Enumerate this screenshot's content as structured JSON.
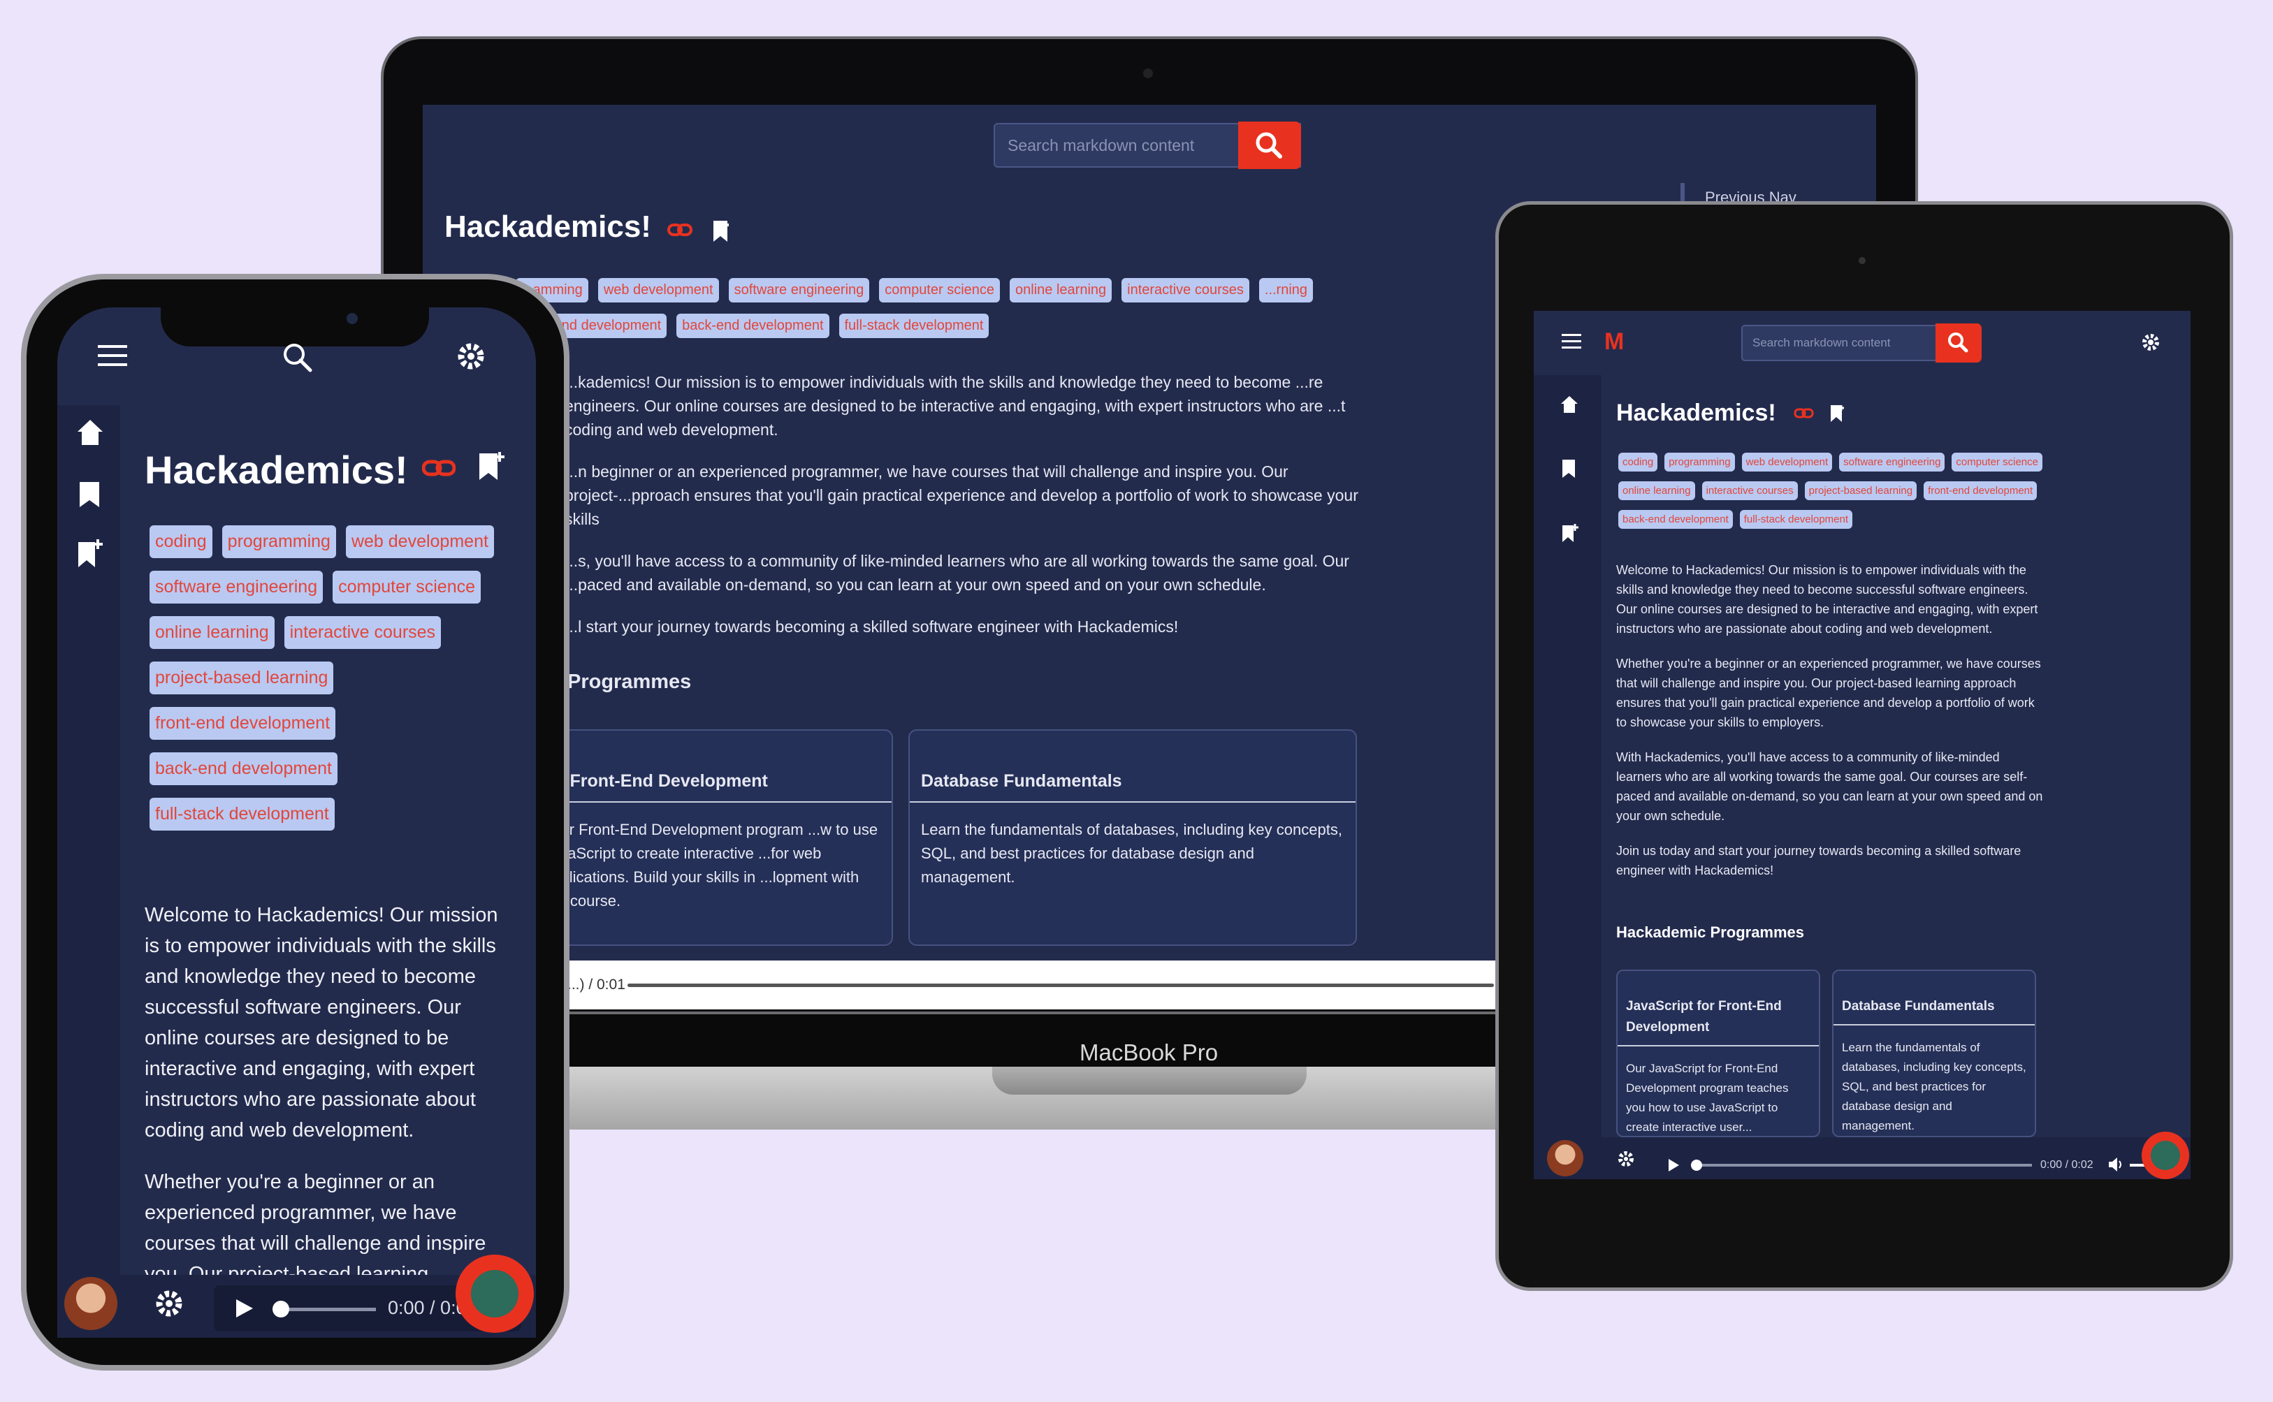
{
  "colors": {
    "background": "#ebe4fb",
    "screen": "#232b4d",
    "sidebar": "#1d2443",
    "accent": "#e8321f",
    "tag_bg": "#b9c9f2",
    "tag_text": "#e2463b"
  },
  "laptop": {
    "search_placeholder": "Search markdown content",
    "title": "Hackademics!",
    "prev_nav": "Previous Nav",
    "tags": [
      "...amming",
      "web development",
      "software engineering",
      "computer science",
      "online learning",
      "interactive courses",
      "...rning",
      "front-end development",
      "back-end development",
      "full-stack development"
    ],
    "paragraphs": [
      "...kademics! Our mission is to empower individuals with the skills and knowledge they need to become ...re engineers. Our online courses are designed to be interactive and engaging, with expert instructors who are ...t coding and web development.",
      "...n beginner or an experienced programmer, we have courses that will challenge and inspire you. Our project-...pproach ensures that you'll gain practical experience and develop a portfolio of work to showcase your skills",
      "...s, you'll have access to a community of like-minded learners who are all working towards the same goal. Our ...paced and available on-demand, so you can learn at your own speed and on your own schedule.",
      "...l start your journey towards becoming a skilled software engineer with Hackademics!"
    ],
    "programmes_heading": "Programmes",
    "cards": [
      {
        "title": "...r Front-End Development",
        "text": "...for Front-End Development program ...w to use JavaScript to create interactive ...for web applications. Build your skills in ...lopment with our course."
      },
      {
        "title": "Database Fundamentals",
        "text": "Learn the fundamentals of databases, including key concepts, SQL, and best practices for database design and management."
      }
    ],
    "audio_time": "...) / 0:01",
    "model": "MacBook Pro"
  },
  "tablet": {
    "logo": "M",
    "search_placeholder": "Search markdown content",
    "title": "Hackademics!",
    "tags": [
      "coding",
      "programming",
      "web development",
      "software engineering",
      "computer science",
      "online learning",
      "interactive courses",
      "project-based learning",
      "front-end development",
      "back-end development",
      "full-stack development"
    ],
    "paragraphs": [
      "Welcome to Hackademics! Our mission is to empower individuals with the skills and knowledge they need to become successful software engineers. Our online courses are designed to be interactive and engaging, with expert instructors who are passionate about coding and web development.",
      "Whether you're a beginner or an experienced programmer, we have courses that will challenge and inspire you. Our project-based learning approach ensures that you'll gain practical experience and develop a portfolio of work to showcase your skills to employers.",
      "With Hackademics, you'll have access to a community of like-minded learners who are all working towards the same goal. Our courses are self-paced and available on-demand, so you can learn at your own speed and on your own schedule.",
      "Join us today and start your journey towards becoming a skilled software engineer with Hackademics!"
    ],
    "programmes_heading": "Hackademic Programmes",
    "cards": [
      {
        "title": "JavaScript for Front-End Development",
        "text": "Our JavaScript for Front-End Development program teaches you how to use JavaScript to create interactive user..."
      },
      {
        "title": "Database Fundamentals",
        "text": "Learn the fundamentals of databases, including key concepts, SQL, and best practices for database design and management."
      }
    ],
    "audio_time": "0:00 / 0:02"
  },
  "phone": {
    "title": "Hackademics!",
    "tags": [
      "coding",
      "programming",
      "web development",
      "software engineering",
      "computer science",
      "online learning",
      "interactive courses",
      "project-based learning",
      "front-end development",
      "back-end development",
      "full-stack development"
    ],
    "paragraphs": [
      "Welcome to Hackademics! Our mission is to empower individuals with the skills and knowledge they need to become successful software engineers. Our online courses are designed to be interactive and engaging, with expert instructors who are passionate about coding and web development.",
      "Whether you're a beginner or an experienced programmer, we have courses that will challenge and inspire you. Our project-based learning"
    ],
    "audio_time": "0:00 / 0:0"
  }
}
